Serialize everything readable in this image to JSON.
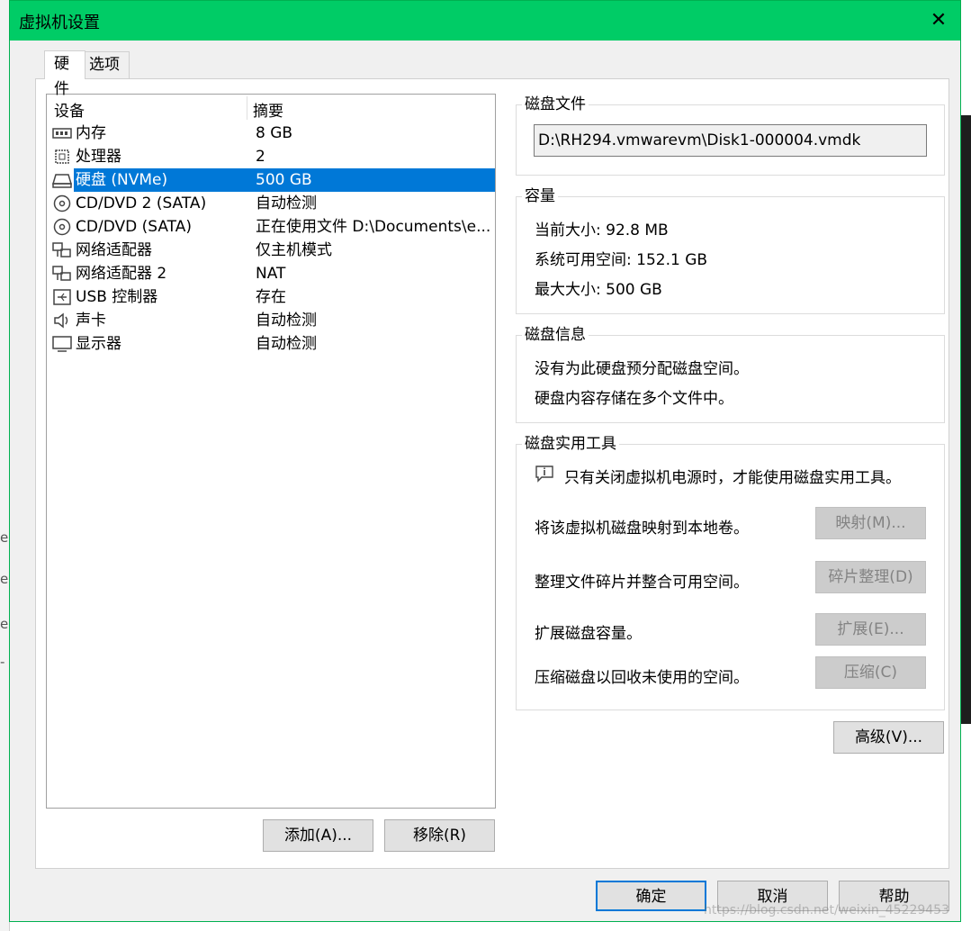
{
  "window": {
    "title": "虚拟机设置",
    "close_glyph": "✕"
  },
  "tabs": [
    {
      "label": "硬件"
    },
    {
      "label": "选项"
    }
  ],
  "device_list": {
    "columns": [
      "设备",
      "摘要"
    ],
    "rows": [
      {
        "name": "内存",
        "summary": "8 GB",
        "icon": "memory-icon"
      },
      {
        "name": "处理器",
        "summary": "2",
        "icon": "processor-icon"
      },
      {
        "name": "硬盘 (NVMe)",
        "summary": "500 GB",
        "icon": "harddisk-icon",
        "selected": true
      },
      {
        "name": "CD/DVD 2 (SATA)",
        "summary": "自动检测",
        "icon": "cd-dvd-icon"
      },
      {
        "name": "CD/DVD (SATA)",
        "summary": "正在使用文件 D:\\Documents\\e...",
        "icon": "cd-dvd-icon"
      },
      {
        "name": "网络适配器",
        "summary": "仅主机模式",
        "icon": "network-adapter-icon"
      },
      {
        "name": "网络适配器 2",
        "summary": "NAT",
        "icon": "network-adapter-icon"
      },
      {
        "name": "USB 控制器",
        "summary": "存在",
        "icon": "usb-icon"
      },
      {
        "name": "声卡",
        "summary": "自动检测",
        "icon": "sound-card-icon"
      },
      {
        "name": "显示器",
        "summary": "自动检测",
        "icon": "display-icon"
      }
    ],
    "add_button": "添加(A)...",
    "remove_button": "移除(R)"
  },
  "disk_file": {
    "legend": "磁盘文件",
    "path": "D:\\RH294.vmwarevm\\Disk1-000004.vmdk"
  },
  "capacity": {
    "legend": "容量",
    "current_size": "当前大小: 92.8 MB",
    "system_free": "系统可用空间: 152.1 GB",
    "max_size": "最大大小: 500 GB"
  },
  "disk_info": {
    "legend": "磁盘信息",
    "line1": "没有为此硬盘预分配磁盘空间。",
    "line2": "硬盘内容存储在多个文件中。"
  },
  "disk_utilities": {
    "legend": "磁盘实用工具",
    "notice": "只有关闭虚拟机电源时，才能使用磁盘实用工具。",
    "map_label": "将该虚拟机磁盘映射到本地卷。",
    "map_button": "映射(M)...",
    "defrag_label": "整理文件碎片并整合可用空间。",
    "defrag_button": "碎片整理(D)",
    "expand_label": "扩展磁盘容量。",
    "expand_button": "扩展(E)...",
    "compact_label": "压缩磁盘以回收未使用的空间。",
    "compact_button": "压缩(C)"
  },
  "advanced_button": "高级(V)...",
  "footer": {
    "ok": "确定",
    "cancel": "取消",
    "help": "帮助"
  },
  "watermark": "https://blog.csdn.net/weixin_45229453",
  "background_chars": [
    "e",
    "e",
    "e",
    "-"
  ],
  "colors": {
    "titlebar": "#00cc66",
    "selection": "#0078d7",
    "dialog_bg": "#f0f0f0"
  }
}
